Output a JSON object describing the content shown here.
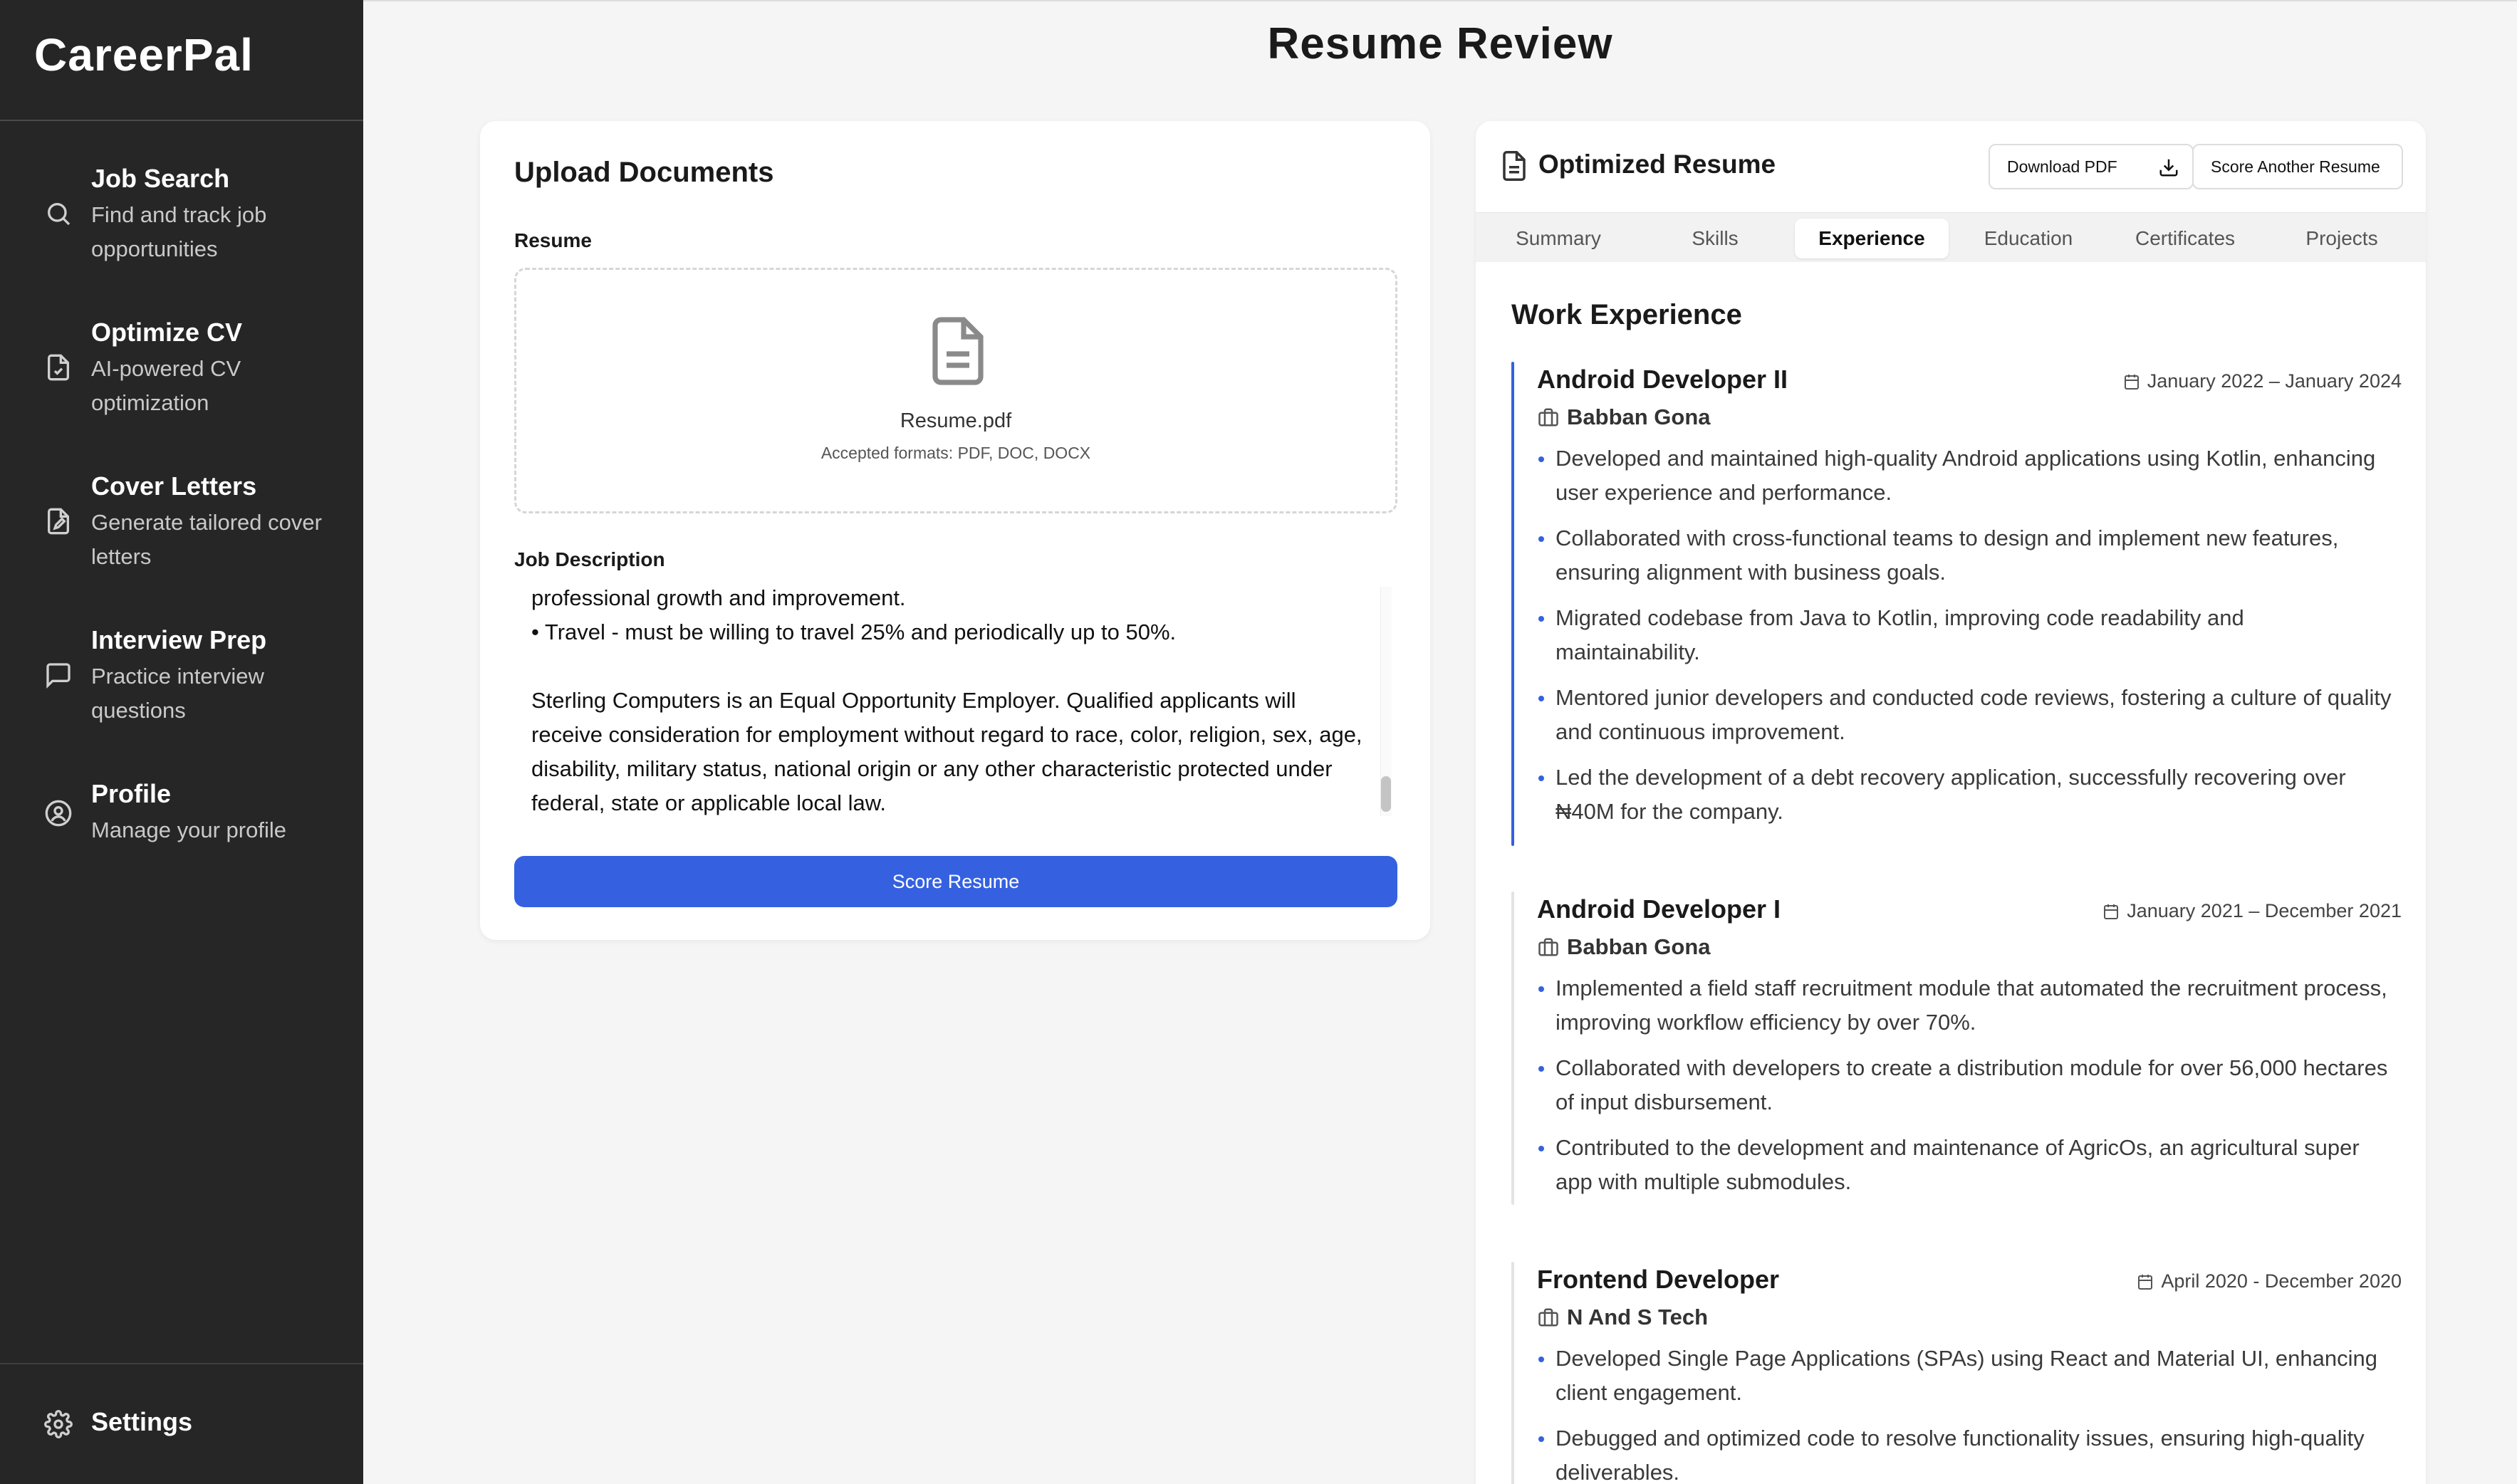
{
  "app": {
    "brand": "CareerPal",
    "page_title": "Resume Review"
  },
  "sidebar": {
    "items": [
      {
        "title": "Job Search",
        "desc": "Find and track job opportunities",
        "icon": "search-icon"
      },
      {
        "title": "Optimize CV",
        "desc": "AI-powered CV optimization",
        "icon": "file-check-icon"
      },
      {
        "title": "Cover Letters",
        "desc": "Generate tailored cover letters",
        "icon": "file-edit-icon"
      },
      {
        "title": "Interview Prep",
        "desc": "Practice interview questions",
        "icon": "message-icon"
      },
      {
        "title": "Profile",
        "desc": "Manage your profile",
        "icon": "user-circle-icon"
      }
    ],
    "settings": {
      "title": "Settings",
      "icon": "gear-icon"
    }
  },
  "upload": {
    "title": "Upload Documents",
    "resume_label": "Resume",
    "file_name": "Resume.pdf",
    "accepted": "Accepted formats: PDF, DOC, DOCX",
    "jd_label": "Job Description",
    "jd_text": "professional growth and improvement.\n• Travel - must be willing to travel 25% and periodically up to 50%.\n\nSterling Computers is an Equal Opportunity Employer. Qualified applicants will receive consideration for employment without regard to race, color, religion, sex, age, disability, military status, national origin or any other characteristic protected under federal, state or applicable local law.",
    "score_button": "Score Resume"
  },
  "resume": {
    "title": "Optimized Resume",
    "download_button": "Download PDF",
    "score_another_button": "Score Another Resume",
    "tabs": [
      "Summary",
      "Skills",
      "Experience",
      "Education",
      "Certificates",
      "Projects"
    ],
    "active_tab": "Experience",
    "section_title": "Work Experience",
    "jobs": [
      {
        "role": "Android Developer II",
        "company": "Babban Gona",
        "dates": "January 2022 – January 2024",
        "bullets": [
          "Developed and maintained high-quality Android applications using Kotlin, enhancing user experience and performance.",
          "Collaborated with cross-functional teams to design and implement new features, ensuring alignment with business goals.",
          "Migrated codebase from Java to Kotlin, improving code readability and maintainability.",
          "Mentored junior developers and conducted code reviews, fostering a culture of quality and continuous improvement.",
          "Led the development of a debt recovery application, successfully recovering over ₦40M for the company."
        ]
      },
      {
        "role": "Android Developer I",
        "company": "Babban Gona",
        "dates": "January 2021 – December 2021",
        "bullets": [
          "Implemented a field staff recruitment module that automated the recruitment process, improving workflow efficiency by over 70%.",
          "Collaborated with developers to create a distribution module for over 56,000 hectares of input disbursement.",
          "Contributed to the development and maintenance of AgricOs, an agricultural super app with multiple submodules."
        ]
      },
      {
        "role": "Frontend Developer",
        "company": "N And S Tech",
        "dates": "April 2020 - December 2020",
        "bullets": [
          "Developed Single Page Applications (SPAs) using React and Material UI, enhancing client engagement.",
          "Debugged and optimized code to resolve functionality issues, ensuring high-quality deliverables."
        ]
      }
    ]
  },
  "colors": {
    "sidebar_bg": "#262626",
    "accent": "#3561e0"
  }
}
